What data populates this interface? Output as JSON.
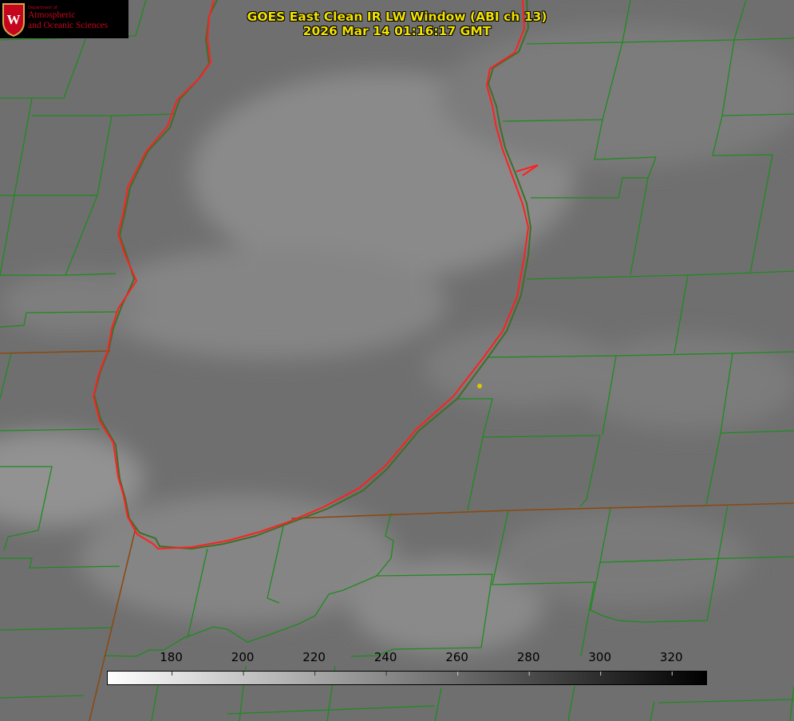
{
  "title": {
    "line1": "GOES East Clean IR LW Window (ABI ch 13)",
    "line2": "2026 Mar 14 01:16:17 GMT"
  },
  "logo": {
    "department": "Department of",
    "line1": "Atmospheric",
    "line2": "and Oceanic Sciences",
    "seal_letter": "W"
  },
  "colorbar": {
    "ticks": [
      "180",
      "200",
      "220",
      "240",
      "260",
      "280",
      "300",
      "320"
    ],
    "min_value": 162,
    "max_value": 330,
    "colormap": "white-to-black (cold bright, warm dark)"
  },
  "colors": {
    "lake_outline": "#ff2020",
    "boundaries": "#1f8a1f",
    "state_line": "#8a4a12",
    "title_text": "#f2e200",
    "marker": "#d8c800",
    "logo_red": "#c5051d"
  },
  "map": {
    "feature": "Lake Michigan outline with county boundaries",
    "marker_icon": "location-dot-icon"
  }
}
